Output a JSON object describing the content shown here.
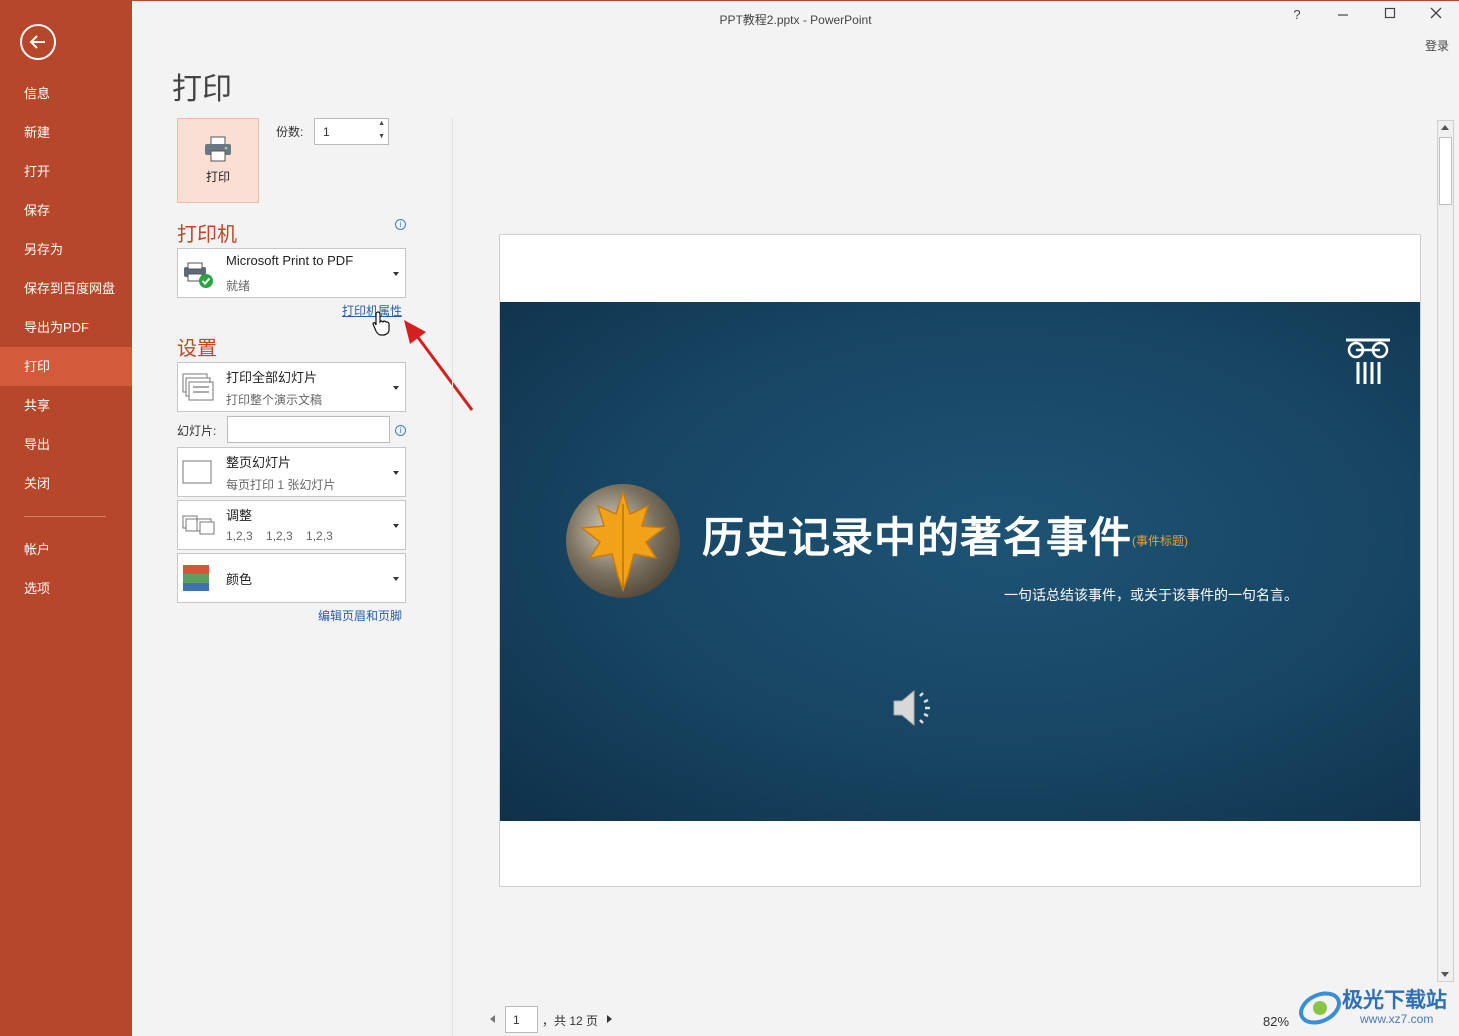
{
  "window": {
    "title": "PPT教程2.pptx - PowerPoint",
    "help": "?",
    "login": "登录"
  },
  "sidebar": {
    "items": [
      {
        "label": "信息"
      },
      {
        "label": "新建"
      },
      {
        "label": "打开"
      },
      {
        "label": "保存"
      },
      {
        "label": "另存为"
      },
      {
        "label": "保存到百度网盘"
      },
      {
        "label": "导出为PDF"
      },
      {
        "label": "打印",
        "active": true
      },
      {
        "label": "共享"
      },
      {
        "label": "导出"
      },
      {
        "label": "关闭"
      }
    ],
    "bottom_items": [
      {
        "label": "帐户"
      },
      {
        "label": "选项"
      }
    ]
  },
  "page": {
    "title": "打印"
  },
  "print": {
    "button_label": "打印",
    "copies_label": "份数:",
    "copies_value": "1"
  },
  "printer": {
    "section_title": "打印机",
    "name": "Microsoft Print to PDF",
    "status": "就绪",
    "properties_link": "打印机属性"
  },
  "settings": {
    "section_title": "设置",
    "range": {
      "main": "打印全部幻灯片",
      "sub": "打印整个演示文稿"
    },
    "slides_label": "幻灯片:",
    "slides_value": "",
    "layout": {
      "main": "整页幻灯片",
      "sub": "每页打印 1 张幻灯片"
    },
    "collate": {
      "main": "调整",
      "sub": "1,2,3    1,2,3    1,2,3"
    },
    "color": {
      "main": "颜色"
    },
    "header_footer_link": "编辑页眉和页脚"
  },
  "slide": {
    "title": "历史记录中的著名事件",
    "tag": "(事件标题)",
    "subtitle": "一句话总结该事件，或关于该事件的一句名言。"
  },
  "pager": {
    "current": "1",
    "total_text": "，共 12 页"
  },
  "zoom": {
    "value": "82%"
  },
  "watermark": {
    "text": "极光下载站",
    "url": "www.xz7.com"
  },
  "colors": {
    "brand": "#b7472a",
    "sidebar_active": "#d35a3a",
    "section_title": "#c0452a",
    "link": "#2a5caa",
    "slide_bg": "#174563",
    "annotation_arrow": "#d62020"
  }
}
